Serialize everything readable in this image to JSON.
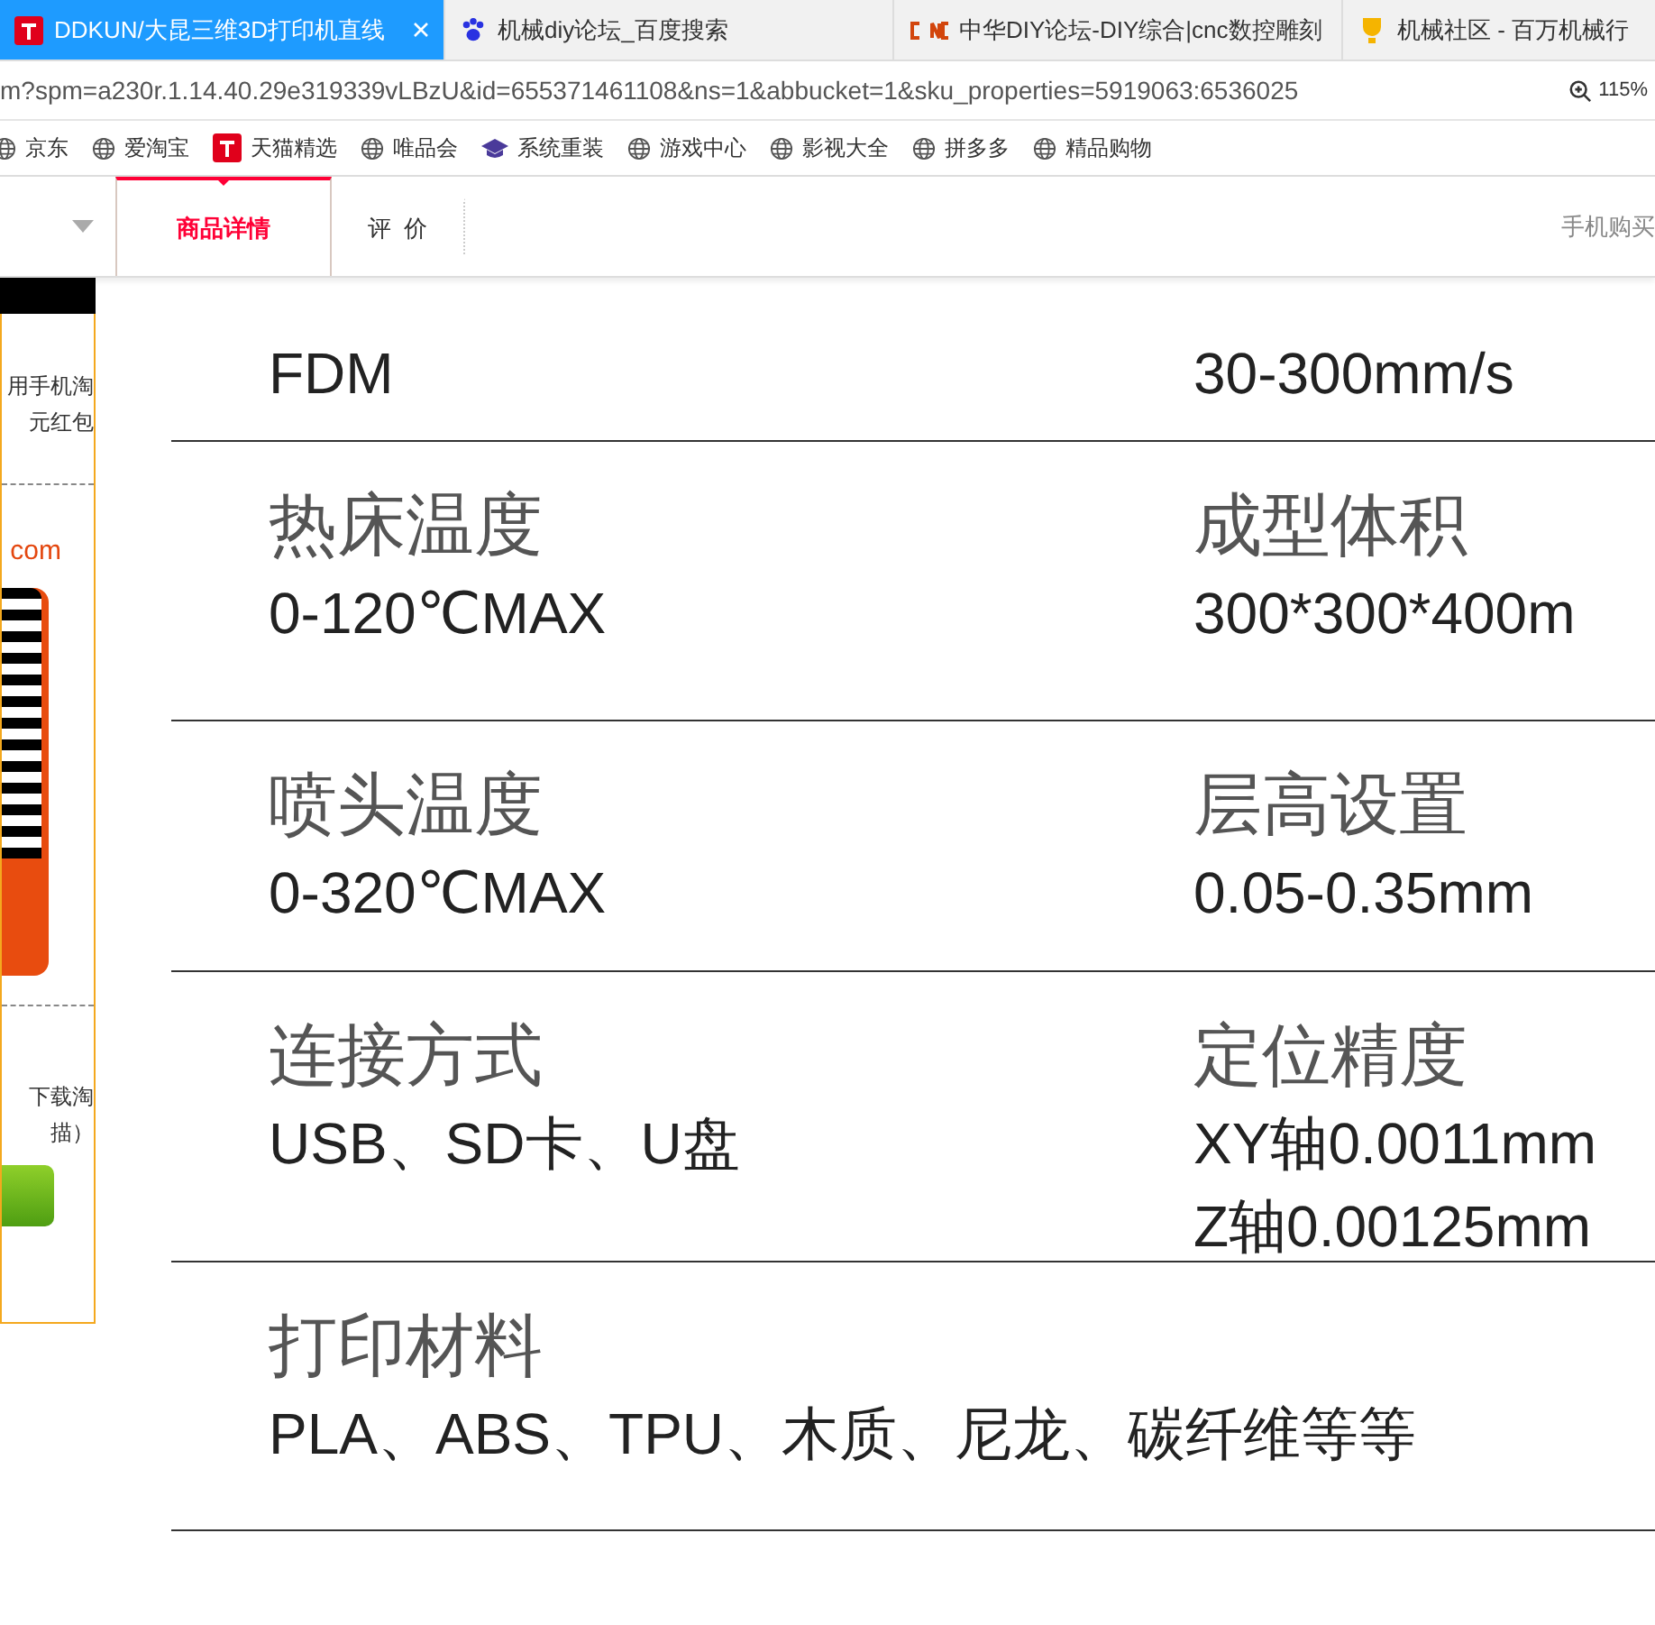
{
  "browser_tabs": [
    {
      "title": "DDKUN/大昆三维3D打印机直线",
      "selected": true,
      "kind": "tmall"
    },
    {
      "title": "机械diy论坛_百度搜索",
      "selected": false,
      "kind": "paw"
    },
    {
      "title": "中华DIY论坛-DIY综合|cnc数控雕刻",
      "selected": false,
      "kind": "cnc"
    },
    {
      "title": "机械社区 - 百万机械行",
      "selected": false,
      "kind": "trophy"
    }
  ],
  "address_bar": {
    "url": "m?spm=a230r.1.14.40.29e319339vLBzU&id=655371461108&ns=1&abbucket=1&sku_properties=5919063:6536025",
    "zoom": "115%"
  },
  "bookmarks": [
    {
      "label": "京东",
      "kind": "globe"
    },
    {
      "label": "爱淘宝",
      "kind": "globe"
    },
    {
      "label": "天猫精选",
      "kind": "tmall"
    },
    {
      "label": "唯品会",
      "kind": "globe"
    },
    {
      "label": "系统重装",
      "kind": "cap"
    },
    {
      "label": "游戏中心",
      "kind": "globe"
    },
    {
      "label": "影视大全",
      "kind": "globe"
    },
    {
      "label": "拼多多",
      "kind": "globe"
    },
    {
      "label": "精品购物",
      "kind": "globe"
    }
  ],
  "page_tabs": [
    {
      "label": "商品详情",
      "selected": true
    },
    {
      "label": "评  价",
      "selected": false
    }
  ],
  "mobile_buy": "手机购买",
  "sidebar": {
    "promo_lines": [
      "用手机淘",
      "元红包"
    ],
    "site": "com",
    "download_lines": [
      "下载淘",
      "描）"
    ]
  },
  "specs": [
    {
      "left": {
        "value": "FDM"
      },
      "right": {
        "value": "30-300mm/s"
      }
    },
    {
      "left": {
        "label": "热床温度",
        "value": "0-120℃MAX"
      },
      "right": {
        "label": "成型体积",
        "value": "300*300*400m"
      }
    },
    {
      "left": {
        "label": "喷头温度",
        "value": "0-320℃MAX"
      },
      "right": {
        "label": "层高设置",
        "value": "0.05-0.35mm"
      }
    },
    {
      "left": {
        "label": "连接方式",
        "value": "USB、SD卡、U盘"
      },
      "right": {
        "label": "定位精度",
        "value": "XY轴0.0011mm",
        "value2": "Z轴0.00125mm"
      }
    },
    {
      "left": {
        "label": "打印材料",
        "value": "PLA、ABS、TPU、木质、尼龙、碳纤维等等"
      }
    }
  ]
}
